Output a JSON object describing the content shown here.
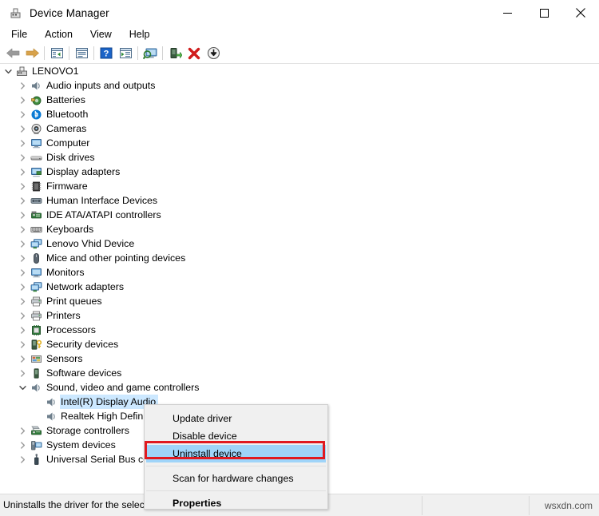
{
  "window": {
    "title": "Device Manager",
    "icon": "device-manager-icon",
    "controls": {
      "minimize": "minimize-icon",
      "maximize": "maximize-icon",
      "close": "close-icon"
    }
  },
  "menubar": {
    "items": [
      {
        "label": "File"
      },
      {
        "label": "Action"
      },
      {
        "label": "View"
      },
      {
        "label": "Help"
      }
    ]
  },
  "toolbar": {
    "buttons": [
      {
        "name": "back-icon"
      },
      {
        "name": "forward-icon"
      },
      {
        "name": "show-hide-console-tree-icon"
      },
      {
        "name": "properties-icon"
      },
      {
        "name": "help-icon"
      },
      {
        "name": "update-driver-icon"
      },
      {
        "name": "scan-for-hardware-changes-icon"
      },
      {
        "name": "enable-device-icon"
      },
      {
        "name": "uninstall-device-icon"
      },
      {
        "name": "download-icon"
      }
    ]
  },
  "tree": {
    "root": {
      "label": "LENOVO1",
      "icon": "computer-root-icon",
      "expanded": true
    },
    "nodes": [
      {
        "label": "Audio inputs and outputs",
        "icon": "speaker-icon",
        "expanded": false,
        "indent": 1
      },
      {
        "label": "Batteries",
        "icon": "battery-icon",
        "expanded": false,
        "indent": 1
      },
      {
        "label": "Bluetooth",
        "icon": "bluetooth-icon",
        "expanded": false,
        "indent": 1
      },
      {
        "label": "Cameras",
        "icon": "camera-icon",
        "expanded": false,
        "indent": 1
      },
      {
        "label": "Computer",
        "icon": "monitor-icon",
        "expanded": false,
        "indent": 1
      },
      {
        "label": "Disk drives",
        "icon": "disk-drive-icon",
        "expanded": false,
        "indent": 1
      },
      {
        "label": "Display adapters",
        "icon": "display-adapter-icon",
        "expanded": false,
        "indent": 1
      },
      {
        "label": "Firmware",
        "icon": "firmware-chip-icon",
        "expanded": false,
        "indent": 1
      },
      {
        "label": "Human Interface Devices",
        "icon": "hid-icon",
        "expanded": false,
        "indent": 1
      },
      {
        "label": "IDE ATA/ATAPI controllers",
        "icon": "ide-controller-icon",
        "expanded": false,
        "indent": 1
      },
      {
        "label": "Keyboards",
        "icon": "keyboard-icon",
        "expanded": false,
        "indent": 1
      },
      {
        "label": "Lenovo Vhid Device",
        "icon": "network-monitor-icon",
        "expanded": false,
        "indent": 1
      },
      {
        "label": "Mice and other pointing devices",
        "icon": "mouse-icon",
        "expanded": false,
        "indent": 1
      },
      {
        "label": "Monitors",
        "icon": "monitor-icon",
        "expanded": false,
        "indent": 1
      },
      {
        "label": "Network adapters",
        "icon": "network-adapter-icon",
        "expanded": false,
        "indent": 1
      },
      {
        "label": "Print queues",
        "icon": "printer-icon",
        "expanded": false,
        "indent": 1
      },
      {
        "label": "Printers",
        "icon": "printer-icon",
        "expanded": false,
        "indent": 1
      },
      {
        "label": "Processors",
        "icon": "processor-icon",
        "expanded": false,
        "indent": 1
      },
      {
        "label": "Security devices",
        "icon": "security-device-icon",
        "expanded": false,
        "indent": 1
      },
      {
        "label": "Sensors",
        "icon": "sensor-icon",
        "expanded": false,
        "indent": 1
      },
      {
        "label": "Software devices",
        "icon": "software-device-icon",
        "expanded": false,
        "indent": 1
      },
      {
        "label": "Sound, video and game controllers",
        "icon": "speaker-icon",
        "expanded": true,
        "indent": 1
      },
      {
        "label": "Intel(R) Display Audio",
        "icon": "speaker-icon",
        "expanded": null,
        "indent": 2,
        "selected": true
      },
      {
        "label": "Realtek High Definition Audio",
        "icon": "speaker-icon",
        "expanded": null,
        "indent": 2
      },
      {
        "label": "Storage controllers",
        "icon": "storage-controller-icon",
        "expanded": false,
        "indent": 1
      },
      {
        "label": "System devices",
        "icon": "system-device-icon",
        "expanded": false,
        "indent": 1
      },
      {
        "label": "Universal Serial Bus controllers",
        "icon": "usb-icon",
        "expanded": false,
        "indent": 1
      }
    ]
  },
  "context_menu": {
    "items": [
      {
        "label": "Update driver",
        "type": "item"
      },
      {
        "label": "Disable device",
        "type": "item"
      },
      {
        "label": "Uninstall device",
        "type": "item",
        "highlighted": true
      },
      {
        "type": "separator"
      },
      {
        "label": "Scan for hardware changes",
        "type": "item"
      },
      {
        "type": "separator"
      },
      {
        "label": "Properties",
        "type": "item",
        "bold": true
      }
    ],
    "highlight_color": "#9fd4f9",
    "annotation_box_color": "#e01a20"
  },
  "statusbar": {
    "text": "Uninstalls the driver for the selected device.",
    "watermark": "wsxdn.com"
  }
}
